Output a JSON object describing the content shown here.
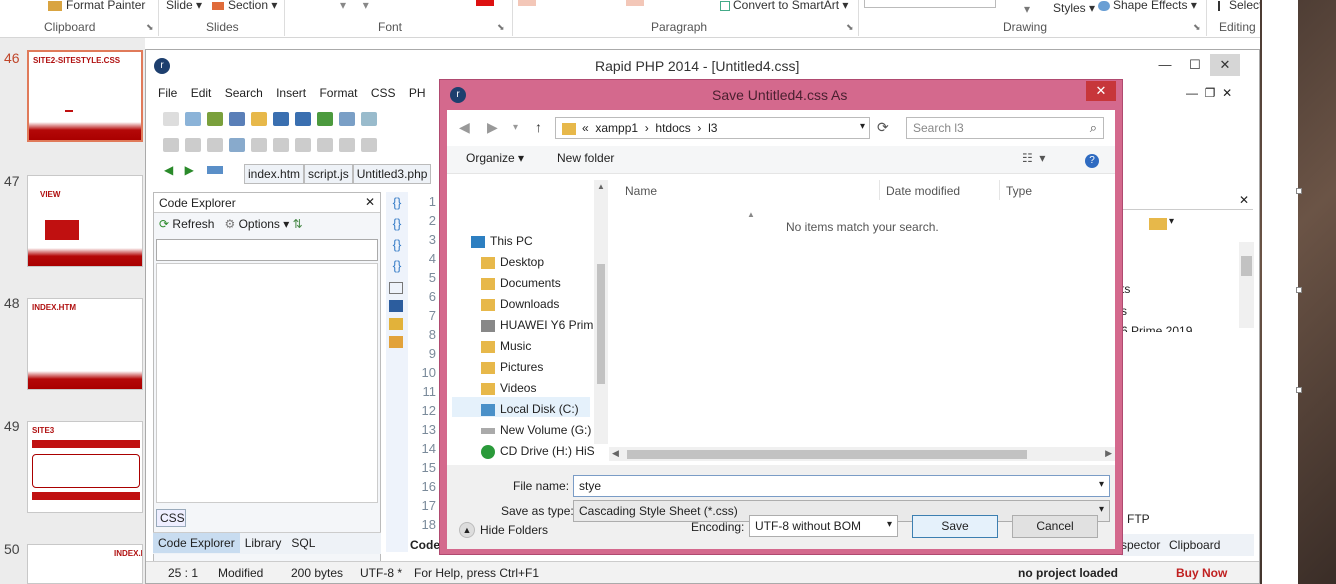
{
  "ribbon": {
    "format_painter": "Format Painter",
    "slide": "Slide",
    "section": "Section",
    "convert_smartart": "Convert to SmartArt",
    "styles": "Styles",
    "shape_effects": "Shape Effects",
    "select": "Select",
    "groups": [
      "Clipboard",
      "Slides",
      "Font",
      "Paragraph",
      "Drawing",
      "Editing"
    ]
  },
  "slides": [
    {
      "num": "46",
      "title": "SITE2-SITESTYLE.CSS"
    },
    {
      "num": "47",
      "title": "VIEW"
    },
    {
      "num": "48",
      "title": "INDEX.HTM"
    },
    {
      "num": "49",
      "title": "SITE3"
    },
    {
      "num": "50",
      "title": "INDEX.H"
    }
  ],
  "editor": {
    "title": "Rapid PHP 2014 - [Untitled4.css]",
    "menu": [
      "File",
      "Edit",
      "Search",
      "Insert",
      "Format",
      "CSS",
      "PH"
    ],
    "tabs": [
      "index.htm",
      "script.js",
      "Untitled3.php"
    ],
    "code_explorer": {
      "title": "Code Explorer",
      "refresh": "Refresh",
      "options": "Options",
      "css_label": "CSS"
    },
    "bottom_tabs": [
      "Code Explorer",
      "Library",
      "SQL"
    ],
    "code_tab": "Code",
    "line_numbers": [
      "1",
      "2",
      "3",
      "4",
      "5",
      "6",
      "7",
      "8",
      "9",
      "10",
      "11",
      "12",
      "13",
      "14",
      "15",
      "16",
      "17",
      "18"
    ],
    "status": {
      "pos": "25 : 1",
      "state": "Modified",
      "size": "200 bytes",
      "encoding": "UTF-8 *",
      "help": "For Help, press Ctrl+F1",
      "project": "no project loaded",
      "buy": "Buy Now"
    },
    "right_pane": {
      "items": [
        "ts",
        "s",
        "6 Prime 2019"
      ],
      "ftp": "FTP",
      "tabs": [
        "spector",
        "Clipboard"
      ]
    }
  },
  "dialog": {
    "title": "Save Untitled4.css As",
    "path": [
      "«",
      "xampp1",
      "htdocs",
      "l3"
    ],
    "search_placeholder": "Search l3",
    "organize": "Organize",
    "new_folder": "New folder",
    "tree": [
      "This PC",
      "Desktop",
      "Documents",
      "Downloads",
      "HUAWEI Y6 Prim",
      "Music",
      "Pictures",
      "Videos",
      "Local Disk (C:)",
      "New Volume (G:)",
      "CD Drive (H:) HiS"
    ],
    "columns": [
      "Name",
      "Date modified",
      "Type"
    ],
    "empty_msg": "No items match your search.",
    "file_name_label": "File name:",
    "file_name_value": "stye",
    "save_type_label": "Save as type:",
    "save_type_value": "Cascading Style Sheet (*.css)",
    "hide_folders": "Hide Folders",
    "encoding_label": "Encoding:",
    "encoding_value": "UTF-8 without BOM",
    "save": "Save",
    "cancel": "Cancel"
  }
}
